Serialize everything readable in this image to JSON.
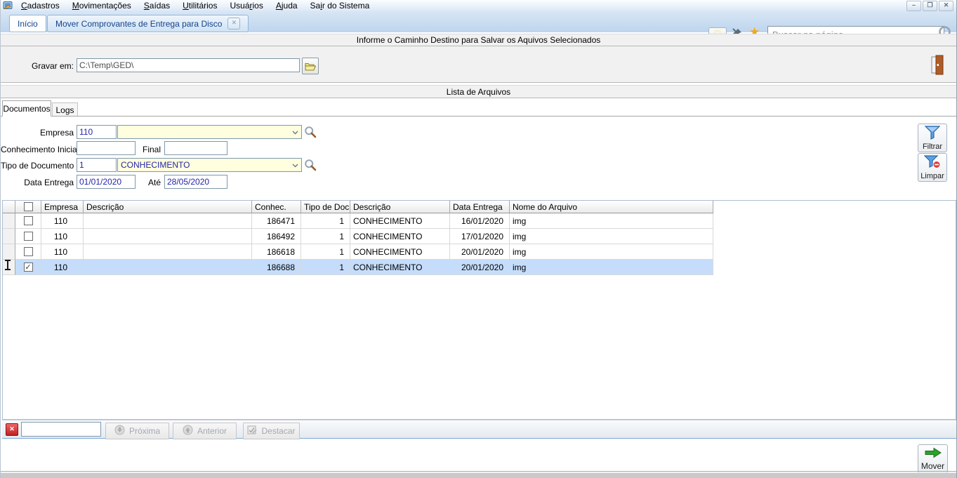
{
  "menubar": {
    "items": [
      {
        "label": "Cadastros",
        "u": 0
      },
      {
        "label": "Movimentações",
        "u": 0
      },
      {
        "label": "Saídas",
        "u": 0
      },
      {
        "label": "Utilitários",
        "u": 0
      },
      {
        "label": "Usuários",
        "u": 4
      },
      {
        "label": "Ajuda",
        "u": 0
      },
      {
        "label": "Sair do Sistema",
        "u": 2
      }
    ]
  },
  "window_controls": {
    "minimize": "–",
    "restore": "❐",
    "close": "✕"
  },
  "tabs": {
    "home": "Início",
    "current": "Mover Comprovantes de Entrega para Disco",
    "close_icon": "✕"
  },
  "quickbar": {
    "search_placeholder": "Buscar na página",
    "star_icon": "★",
    "chevron_icon": "♡"
  },
  "path_section": {
    "header": "Informe o Caminho Destino para Salvar os Aquivos Selecionados",
    "label": "Gravar em:",
    "value": "C:\\Temp\\GED\\"
  },
  "list_section": {
    "header": "Lista de Arquivos",
    "tab_documentos": "Documentos",
    "tab_logs": "Logs"
  },
  "filters": {
    "empresa_label": "Empresa",
    "empresa_code": "110",
    "empresa_name": "",
    "conhecimento_label": "Conhecimento Inicial",
    "final_label": "Final",
    "conhecimento_inicial": "",
    "conhecimento_final": "",
    "tipo_label": "Tipo de Documento",
    "tipo_code": "1",
    "tipo_name": "CONHECIMENTO",
    "data_label": "Data Entrega",
    "ate_label": "Até",
    "data_inicial": "01/01/2020",
    "data_final": "28/05/2020",
    "filtrar_label": "Filtrar",
    "limpar_label": "Limpar"
  },
  "grid": {
    "columns": [
      "Empresa",
      "Descrição",
      "Conhec.",
      "Tipo de Doc.",
      "Descrição",
      "Data Entrega",
      "Nome do Arquivo"
    ],
    "rows": [
      {
        "checked": false,
        "selected": false,
        "empresa": "110",
        "descricao": "",
        "conhec": "186471",
        "tipo_doc": "1",
        "tipo_descricao": "CONHECIMENTO",
        "data_entrega": "16/01/2020",
        "nome_arquivo": "img"
      },
      {
        "checked": false,
        "selected": false,
        "empresa": "110",
        "descricao": "",
        "conhec": "186492",
        "tipo_doc": "1",
        "tipo_descricao": "CONHECIMENTO",
        "data_entrega": "17/01/2020",
        "nome_arquivo": "img"
      },
      {
        "checked": false,
        "selected": false,
        "empresa": "110",
        "descricao": "",
        "conhec": "186618",
        "tipo_doc": "1",
        "tipo_descricao": "CONHECIMENTO",
        "data_entrega": "20/01/2020",
        "nome_arquivo": "img"
      },
      {
        "checked": true,
        "selected": true,
        "empresa": "110",
        "descricao": "",
        "conhec": "186688",
        "tipo_doc": "1",
        "tipo_descricao": "CONHECIMENTO",
        "data_entrega": "20/01/2020",
        "nome_arquivo": "img"
      }
    ]
  },
  "find_bar": {
    "close_icon": "✕",
    "search_value": "",
    "proxima_label": "Próxima",
    "anterior_label": "Anterior",
    "destacar_label": "Destacar"
  },
  "actions": {
    "mover_label": "Mover"
  },
  "icons": {
    "check": "✓"
  },
  "colors": {
    "accent_blue": "#15428b",
    "combo_bg": "#ffffdf",
    "selected_row": "#c5ddfb",
    "star": "#f2a71d",
    "mover_green": "#2ba32b"
  }
}
